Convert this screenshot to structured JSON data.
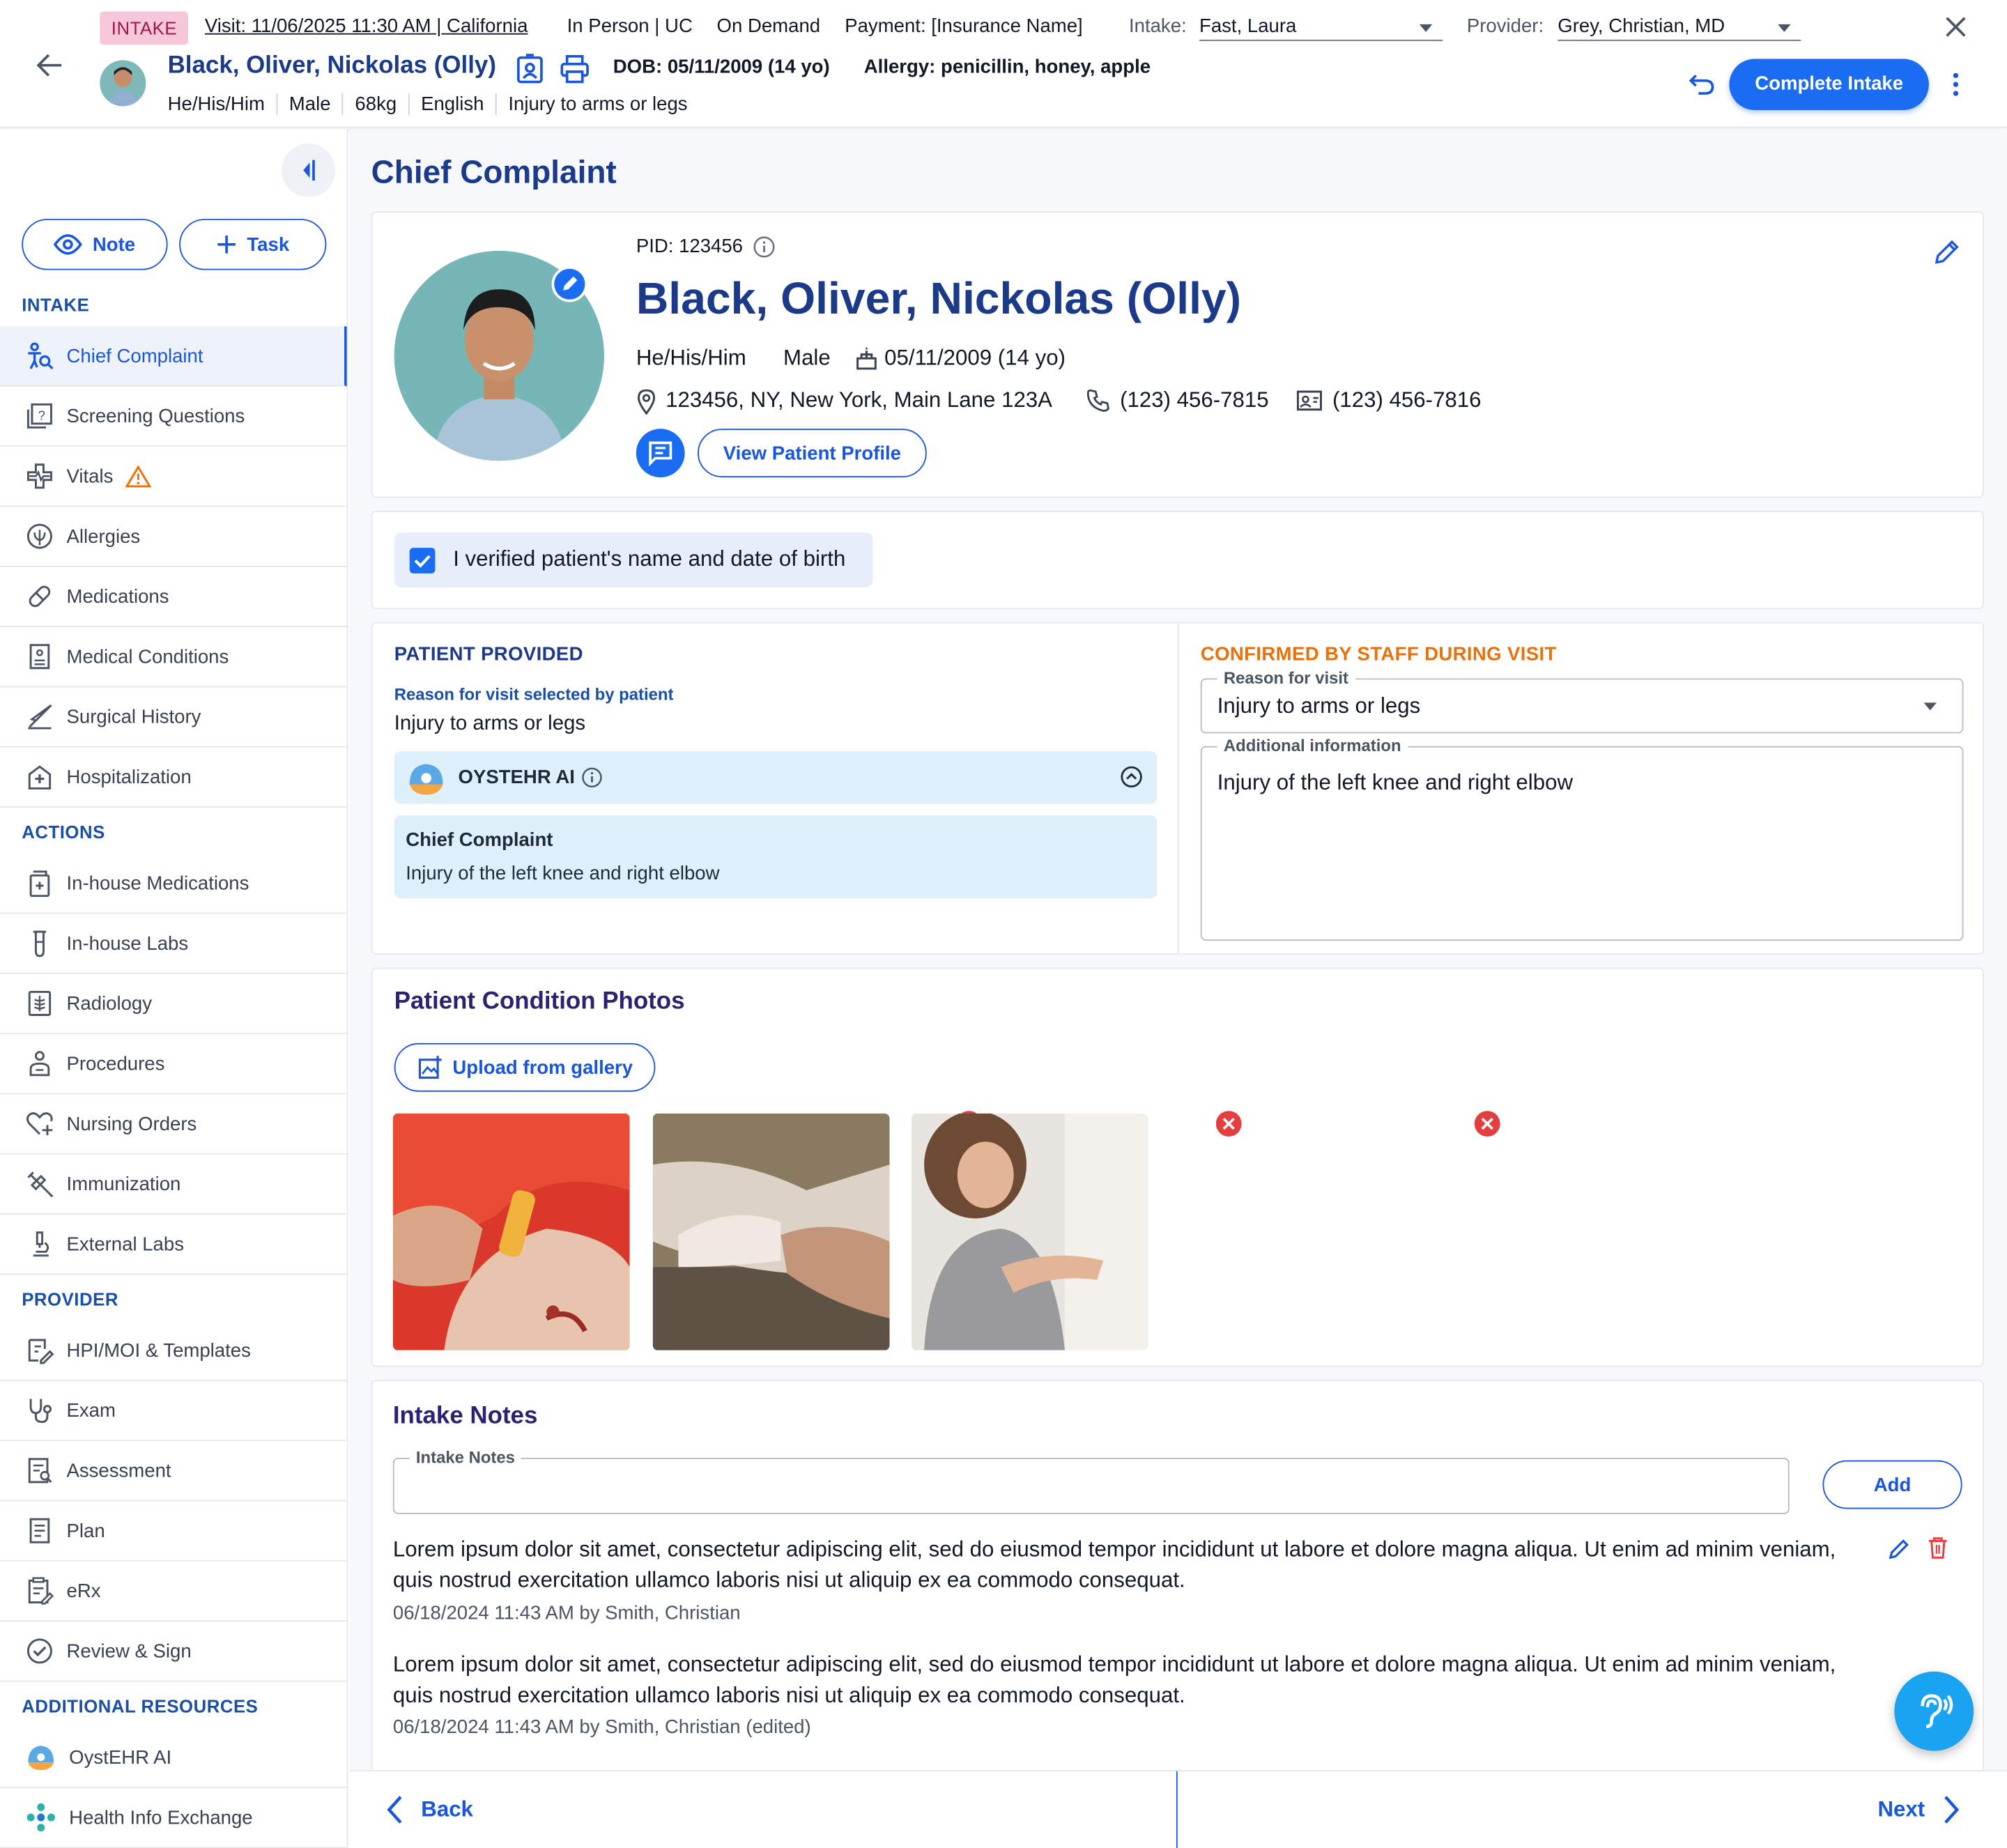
{
  "header": {
    "badge": "INTAKE",
    "visit": "Visit: 11/06/2025 11:30 AM | California",
    "mode": "In Person | UC",
    "schedule": "On Demand",
    "payment": "Payment: [Insurance Name]",
    "intake_label": "Intake:",
    "intake_value": "Fast, Laura",
    "provider_label": "Provider:",
    "provider_value": "Grey, Christian, MD",
    "patient_name": "Black, Oliver, Nickolas (Olly)",
    "dob": "DOB: 05/11/2009 (14 yo)",
    "allergy": "Allergy: penicillin, honey, apple",
    "meta": [
      "He/His/Him",
      "Male",
      "68kg",
      "English",
      "Injury to arms or legs"
    ],
    "complete_button": "Complete Intake"
  },
  "sidebar": {
    "note_button": "Note",
    "task_button": "Task",
    "sections": {
      "intake": "INTAKE",
      "actions": "ACTIONS",
      "provider": "PROVIDER",
      "resources": "ADDITIONAL RESOURCES"
    },
    "intake_items": [
      "Chief Complaint",
      "Screening Questions",
      "Vitals",
      "Allergies",
      "Medications",
      "Medical Conditions",
      "Surgical History",
      "Hospitalization"
    ],
    "action_items": [
      "In-house Medications",
      "In-house Labs",
      "Radiology",
      "Procedures",
      "Nursing Orders",
      "Immunization",
      "External Labs"
    ],
    "provider_items": [
      "HPI/MOI & Templates",
      "Exam",
      "Assessment",
      "Plan",
      "eRx",
      "Review & Sign"
    ],
    "resource_items": [
      "OystEHR AI",
      "Health Info Exchange"
    ]
  },
  "main": {
    "page_title": "Chief Complaint",
    "patient": {
      "pid": "PID: 123456",
      "name": "Black, Oliver, Nickolas (Olly)",
      "pronouns": "He/His/Him",
      "sex": "Male",
      "dob": "05/11/2009 (14 yo)",
      "address": "123456, NY, New York, Main Lane 123A",
      "phone": "(123) 456-7815",
      "fax": "(123) 456-7816",
      "profile_button": "View Patient Profile"
    },
    "verify": {
      "label": "I verified patient's name and date of birth",
      "checked": true
    },
    "patient_provided": {
      "heading": "PATIENT PROVIDED",
      "reason_label": "Reason for visit selected by patient",
      "reason_value": "Injury to arms or legs",
      "ai_title": "OYSTEHR AI",
      "cc_title": "Chief Complaint",
      "cc_text": "Injury of the left knee and right elbow"
    },
    "confirmed": {
      "heading": "CONFIRMED BY STAFF DURING VISIT",
      "reason_label": "Reason for visit",
      "reason_value": "Injury to arms or legs",
      "info_label": "Additional information",
      "info_value": "Injury of the left knee and right elbow"
    },
    "photos": {
      "title": "Patient Condition Photos",
      "upload_button": "Upload from gallery"
    },
    "notes": {
      "title": "Intake Notes",
      "field_label": "Intake Notes",
      "add_button": "Add",
      "items": [
        {
          "text": "Lorem ipsum dolor sit amet, consectetur adipiscing elit, sed do eiusmod tempor incididunt ut labore et dolore magna aliqua. Ut enim ad minim veniam, quis nostrud exercitation ullamco laboris nisi ut aliquip ex ea commodo consequat.",
          "meta": "06/18/2024 11:43 AM by Smith, Christian"
        },
        {
          "text": "Lorem ipsum dolor sit amet, consectetur adipiscing elit, sed do eiusmod tempor incididunt ut labore et dolore magna aliqua. Ut enim ad minim veniam, quis nostrud exercitation ullamco laboris nisi ut aliquip ex ea commodo consequat.",
          "meta": "06/18/2024 11:43 AM by Smith, Christian (edited)"
        }
      ]
    },
    "footer": {
      "back": "Back",
      "next": "Next"
    }
  },
  "colors": {
    "accent": "#1a56db",
    "navy": "#1b3a8a",
    "warning": "#e8710a",
    "danger": "#e53e3e",
    "fab": "#1aa3f0"
  }
}
